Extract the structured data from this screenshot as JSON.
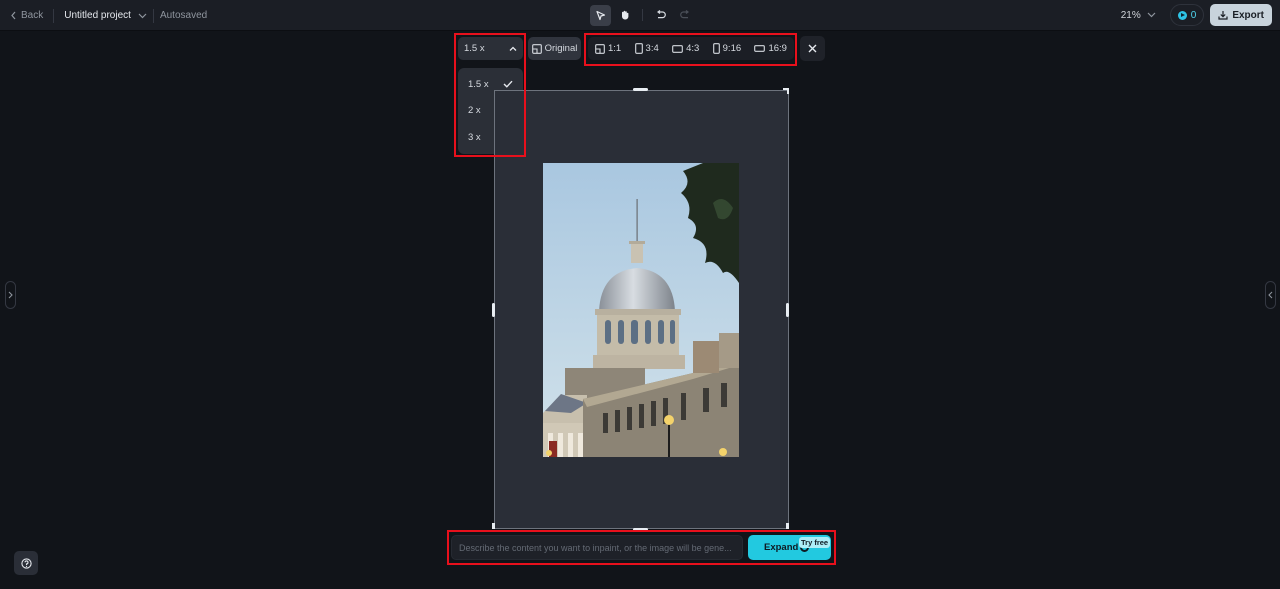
{
  "topbar": {
    "back_label": "Back",
    "project_title": "Untitled project",
    "save_status": "Autosaved",
    "zoom_level": "21%",
    "credits": "0",
    "export_label": "Export"
  },
  "tools": [
    {
      "name": "select",
      "icon": "cursor-icon",
      "active": true
    },
    {
      "name": "hand",
      "icon": "hand-icon",
      "active": false
    },
    {
      "name": "undo",
      "icon": "undo-icon",
      "active": false
    },
    {
      "name": "redo",
      "icon": "redo-icon",
      "active": false,
      "disabled": true
    }
  ],
  "expand_toolbar": {
    "scale_selected": "1.5 x",
    "scale_options": [
      {
        "label": "1.5 x",
        "selected": true
      },
      {
        "label": "2 x",
        "selected": false
      },
      {
        "label": "3 x",
        "selected": false
      }
    ],
    "original_label": "Original",
    "ratios": [
      {
        "label": "1:1",
        "icon": "ratio-free-icon"
      },
      {
        "label": "3:4",
        "icon": "portrait-rect-icon"
      },
      {
        "label": "4:3",
        "icon": "landscape-rect-icon"
      },
      {
        "label": "9:16",
        "icon": "tall-rect-icon"
      },
      {
        "label": "16:9",
        "icon": "wide-rect-icon"
      }
    ]
  },
  "canvas": {
    "image_description": "Dome of Bonsecours Market building against blue sky"
  },
  "prompt": {
    "placeholder": "Describe the content you want to inpaint, or the image will be gene...",
    "value": ""
  },
  "expand_button": {
    "label": "Expand",
    "credit_cost": "0",
    "badge": "Try free"
  },
  "colors": {
    "accent": "#22c9e0",
    "highlight": "#e8101c",
    "background": "#111419",
    "topbar": "#1b1e25"
  }
}
